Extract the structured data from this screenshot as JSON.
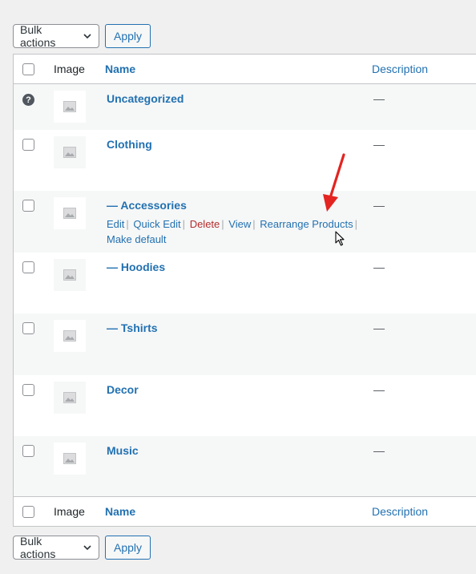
{
  "bulk_top": {
    "select_label": "Bulk actions",
    "apply_label": "Apply"
  },
  "bulk_bottom": {
    "select_label": "Bulk actions",
    "apply_label": "Apply"
  },
  "table": {
    "headers": {
      "image": "Image",
      "name": "Name",
      "description": "Description"
    },
    "rows": [
      {
        "name": "Uncategorized",
        "description": "—"
      },
      {
        "name": "Clothing",
        "description": "—"
      },
      {
        "name": "— Accessories",
        "description": "—",
        "actions": {
          "edit": "Edit",
          "quick_edit": "Quick Edit",
          "delete": "Delete",
          "view": "View",
          "rearrange": "Rearrange Products",
          "make_default": "Make default"
        }
      },
      {
        "name": "— Hoodies",
        "description": "—"
      },
      {
        "name": "— Tshirts",
        "description": "—"
      },
      {
        "name": "Decor",
        "description": "—"
      },
      {
        "name": "Music",
        "description": "—"
      }
    ]
  },
  "icons": {
    "help": "question-circle-icon",
    "placeholder": "image-placeholder-icon",
    "arrow": "red-arrow-annotation",
    "cursor": "mouse-cursor-icon"
  },
  "colors": {
    "link": "#2271b1",
    "delete": "#b32d2e",
    "arrow": "#e32420"
  }
}
